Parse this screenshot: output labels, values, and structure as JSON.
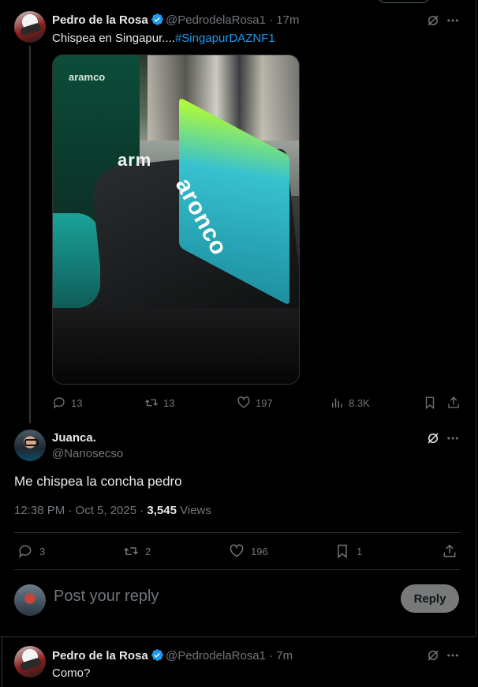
{
  "colors": {
    "accent": "#1d9bf0",
    "verified": "#1d9bf0",
    "muted": "#71767b",
    "text": "#e7e9ea",
    "background": "#000000"
  },
  "tweet1": {
    "name": "Pedro de la Rosa",
    "handle_time": "@PedrodelaRosa1 · 17m",
    "text": "Chispea en Singapur....",
    "hashtag": "#SingapurDAZNF1",
    "image_texts": {
      "logo": "aramco",
      "arm": "arm",
      "endplate": "aronco"
    },
    "actions": {
      "replies": "13",
      "reposts": "13",
      "likes": "197",
      "views": "8.3K"
    }
  },
  "reply": {
    "name": "Juanca.",
    "handle": "@Nanosecso",
    "text": "Me chispea la concha pedro",
    "meta_time": "12:38 PM · Oct 5, 2025 · ",
    "meta_views_count": "3,545",
    "meta_views_label": " Views",
    "actions": {
      "replies": "3",
      "reposts": "2",
      "likes": "196",
      "bookmarks": "1"
    }
  },
  "composer": {
    "placeholder": "Post your reply",
    "button": "Reply"
  },
  "tweet3": {
    "name": "Pedro de la Rosa",
    "handle_time": "@PedrodelaRosa1 · 7m",
    "text": "Como?"
  },
  "icons": [
    "verified-icon",
    "grok-icon",
    "more-icon",
    "reply-icon",
    "repost-icon",
    "like-icon",
    "views-icon",
    "bookmark-icon",
    "share-icon"
  ]
}
